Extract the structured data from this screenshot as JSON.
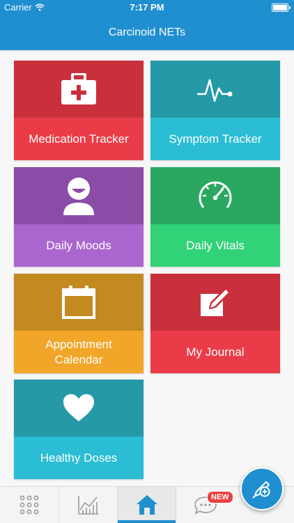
{
  "status_bar": {
    "carrier": "Carrier",
    "time": "7:17 PM"
  },
  "nav": {
    "title": "Carcinoid NETs"
  },
  "tiles": [
    {
      "label": "Medication Tracker",
      "icon": "medical-kit-icon",
      "top_color": "#c9303b",
      "bottom_color": "#ea3c48"
    },
    {
      "label": "Symptom Tracker",
      "icon": "heartbeat-icon",
      "top_color": "#2599a8",
      "bottom_color": "#2bbdd4"
    },
    {
      "label": "Daily Moods",
      "icon": "smiley-person-icon",
      "top_color": "#8a4ca7",
      "bottom_color": "#ab65cf"
    },
    {
      "label": "Daily Vitals",
      "icon": "speedometer-icon",
      "top_color": "#2aa861",
      "bottom_color": "#32d279"
    },
    {
      "label": "Appointment Calendar",
      "icon": "calendar-icon",
      "top_color": "#c38a22",
      "bottom_color": "#f1a629"
    },
    {
      "label": "My Journal",
      "icon": "journal-edit-icon",
      "top_color": "#c9303b",
      "bottom_color": "#ea3c48"
    },
    {
      "label": "Healthy Doses",
      "icon": "heart-icon",
      "top_color": "#2599a8",
      "bottom_color": "#2bbdd4"
    }
  ],
  "tab_bar": {
    "tabs": [
      {
        "name": "menu",
        "icon": "grid-dots-icon",
        "active": false
      },
      {
        "name": "charts",
        "icon": "line-chart-icon",
        "active": false
      },
      {
        "name": "home",
        "icon": "home-icon",
        "active": true
      },
      {
        "name": "messages",
        "icon": "chat-bubble-icon",
        "active": false
      }
    ],
    "new_badge": "NEW"
  },
  "fab": {
    "icon": "add-entry-pen-icon"
  },
  "colors": {
    "primary": "#1f8fd0",
    "badge": "#e84040"
  }
}
